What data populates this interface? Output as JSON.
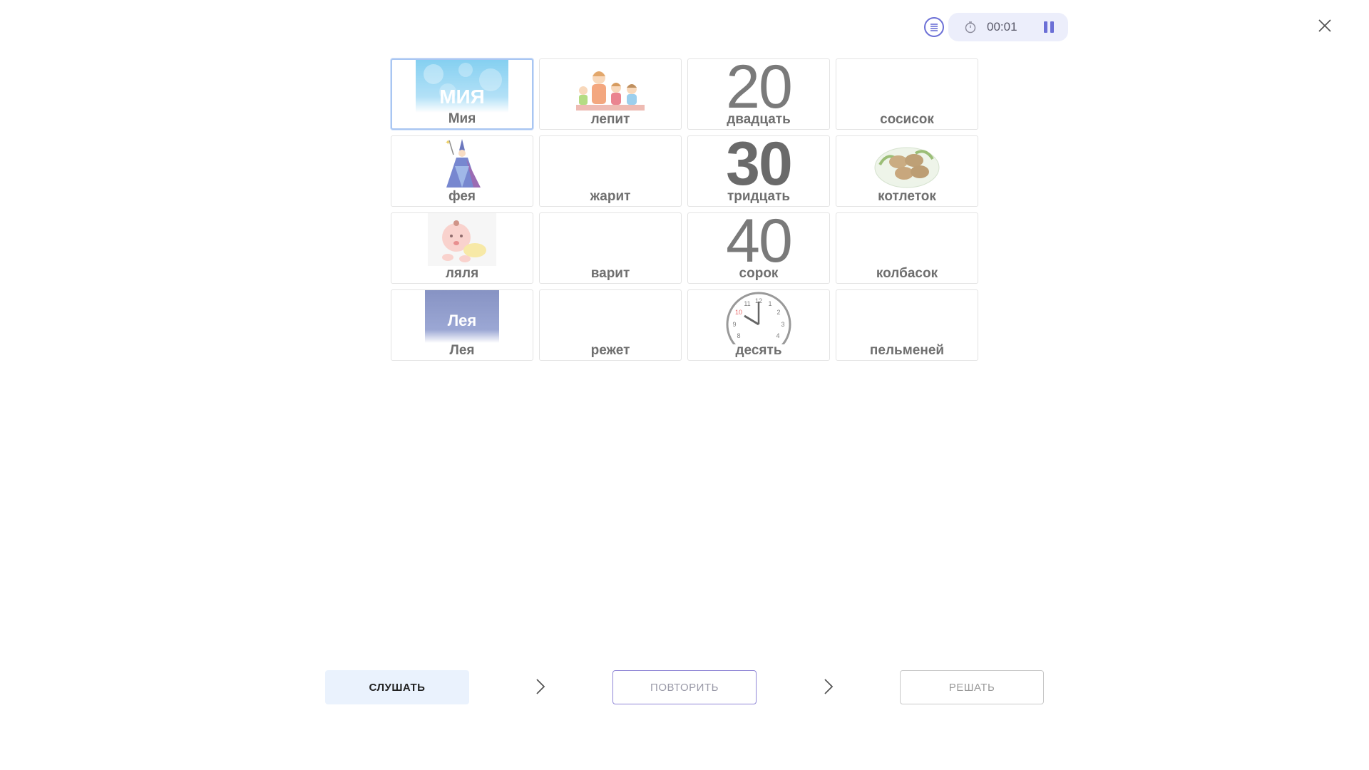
{
  "timer": {
    "time": "00:01"
  },
  "grid": {
    "cells": [
      {
        "label": "Мия",
        "image_text": "МИЯ"
      },
      {
        "label": "лепит"
      },
      {
        "label": "двадцать",
        "number": "20"
      },
      {
        "label": "сосисок"
      },
      {
        "label": "фея"
      },
      {
        "label": "жарит"
      },
      {
        "label": "тридцать",
        "number": "30"
      },
      {
        "label": "котлеток"
      },
      {
        "label": "ляля"
      },
      {
        "label": "варит"
      },
      {
        "label": "сорок",
        "number": "40"
      },
      {
        "label": "колбасок"
      },
      {
        "label": "Лея",
        "image_text": "Лея"
      },
      {
        "label": "режет"
      },
      {
        "label": "десять"
      },
      {
        "label": "пельменей"
      }
    ]
  },
  "clock_face": {
    "numbers": [
      "12",
      "1",
      "2",
      "3",
      "4",
      "8",
      "9",
      "10",
      "11"
    ]
  },
  "buttons": {
    "listen": "СЛУШАТЬ",
    "repeat": "ПОВТОРИТЬ",
    "solve": "РЕШАТЬ"
  },
  "colors": {
    "accent": "#6b6fd6",
    "active_border": "#a9c6f2",
    "listen_bg": "#eaf2fd"
  }
}
